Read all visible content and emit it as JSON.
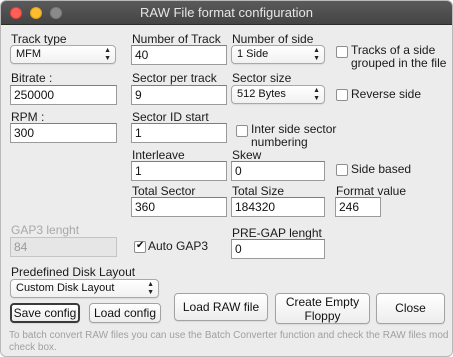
{
  "window": {
    "title": "RAW File format configuration"
  },
  "track_type": {
    "label": "Track type",
    "value": "MFM"
  },
  "bitrate": {
    "label": "Bitrate :",
    "value": "250000"
  },
  "rpm": {
    "label": "RPM :",
    "value": "300"
  },
  "number_of_track": {
    "label": "Number of Track",
    "value": "40"
  },
  "sector_per_track": {
    "label": "Sector per track",
    "value": "9"
  },
  "sector_id_start": {
    "label": "Sector ID start",
    "value": "1"
  },
  "interleave": {
    "label": "Interleave",
    "value": "1"
  },
  "total_sector": {
    "label": "Total Sector",
    "value": "360"
  },
  "number_of_side": {
    "label": "Number of side",
    "value": "1 Side"
  },
  "sector_size": {
    "label": "Sector size",
    "value": "512 Bytes"
  },
  "skew": {
    "label": "Skew",
    "value": "0"
  },
  "total_size": {
    "label": "Total Size",
    "value": "184320"
  },
  "format_value": {
    "label": "Format value",
    "value": "246"
  },
  "options": {
    "tracks_grouped_line1": "Tracks of a side",
    "tracks_grouped_line2": "grouped in the file",
    "reverse_side": "Reverse side",
    "inter_side_line1": "Inter side sector",
    "inter_side_line2": "numbering",
    "side_based": "Side based"
  },
  "gap3": {
    "label": "GAP3 lenght",
    "value": "84",
    "auto_label": "Auto GAP3",
    "auto_checked": true
  },
  "pre_gap": {
    "label": "PRE-GAP lenght",
    "value": "0"
  },
  "predefined": {
    "label": "Predefined Disk Layout",
    "value": "Custom Disk Layout"
  },
  "buttons": {
    "save_config": "Save config",
    "load_config": "Load config",
    "load_raw": "Load RAW file",
    "create_line1": "Create Empty",
    "create_line2": "Floppy",
    "close": "Close"
  },
  "note": "To batch convert RAW files you can use the Batch Converter function and check the RAW files mod check box."
}
